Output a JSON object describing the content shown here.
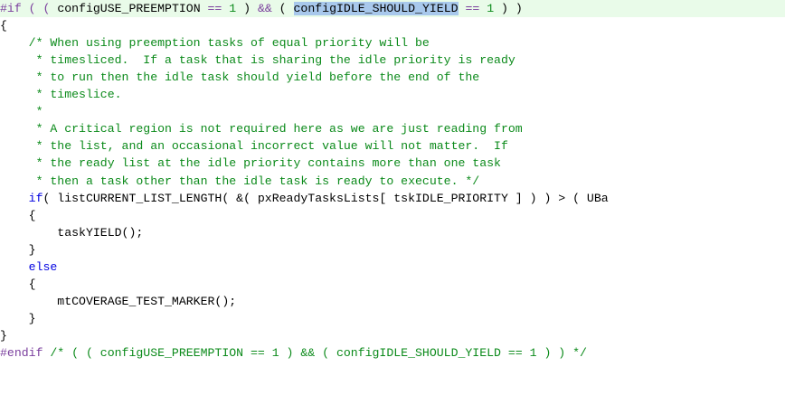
{
  "editor": {
    "lines": [
      {
        "highlight": true,
        "segs": [
          {
            "t": "#if",
            "c": "pre"
          },
          {
            "t": " ( ( ",
            "c": "pre"
          },
          {
            "t": "configUSE_PREEMPTION",
            "c": ""
          },
          {
            "t": " == ",
            "c": "op"
          },
          {
            "t": "1",
            "c": "num"
          },
          {
            "t": " ) ",
            "c": ""
          },
          {
            "t": "&&",
            "c": "op"
          },
          {
            "t": " ( ",
            "c": ""
          },
          {
            "t": "configIDLE_SHOULD_YIELD",
            "c": "sel"
          },
          {
            "t": " == ",
            "c": "op"
          },
          {
            "t": "1",
            "c": "num"
          },
          {
            "t": " ) )",
            "c": ""
          }
        ]
      },
      {
        "segs": [
          {
            "t": "{",
            "c": ""
          }
        ]
      },
      {
        "segs": [
          {
            "t": "    /* When using preemption tasks of equal priority will be",
            "c": "cm"
          }
        ]
      },
      {
        "segs": [
          {
            "t": "     * timesliced.  If a task that is sharing the idle priority is ready",
            "c": "cm"
          }
        ]
      },
      {
        "segs": [
          {
            "t": "     * to run then the idle task should yield before the end of the",
            "c": "cm"
          }
        ]
      },
      {
        "segs": [
          {
            "t": "     * timeslice.",
            "c": "cm"
          }
        ]
      },
      {
        "segs": [
          {
            "t": "     *",
            "c": "cm"
          }
        ]
      },
      {
        "segs": [
          {
            "t": "     * A critical region is not required here as we are just reading from",
            "c": "cm"
          }
        ]
      },
      {
        "segs": [
          {
            "t": "     * the list, and an occasional incorrect value will not matter.  If",
            "c": "cm"
          }
        ]
      },
      {
        "segs": [
          {
            "t": "     * the ready list at the idle priority contains more than one task",
            "c": "cm"
          }
        ]
      },
      {
        "segs": [
          {
            "t": "     * then a task other than the idle task is ready to execute. */",
            "c": "cm"
          }
        ]
      },
      {
        "segs": [
          {
            "t": "    ",
            "c": ""
          },
          {
            "t": "if",
            "c": "kw"
          },
          {
            "t": "( listCURRENT_LIST_LENGTH( &( pxReadyTasksLists[ tskIDLE_PRIORITY ] ) ) > ( UBa",
            "c": ""
          }
        ]
      },
      {
        "segs": [
          {
            "t": "    {",
            "c": ""
          }
        ]
      },
      {
        "segs": [
          {
            "t": "        taskYIELD();",
            "c": ""
          }
        ]
      },
      {
        "segs": [
          {
            "t": "    }",
            "c": ""
          }
        ]
      },
      {
        "segs": [
          {
            "t": "    ",
            "c": ""
          },
          {
            "t": "else",
            "c": "kw"
          }
        ]
      },
      {
        "segs": [
          {
            "t": "    {",
            "c": ""
          }
        ]
      },
      {
        "segs": [
          {
            "t": "        mtCOVERAGE_TEST_MARKER();",
            "c": ""
          }
        ]
      },
      {
        "segs": [
          {
            "t": "    }",
            "c": ""
          }
        ]
      },
      {
        "segs": [
          {
            "t": "}",
            "c": ""
          }
        ]
      },
      {
        "segs": [
          {
            "t": "#endif",
            "c": "pre"
          },
          {
            "t": " /* ( ( configUSE_PREEMPTION == 1 ) && ( configIDLE_SHOULD_YIELD == 1 ) ) */",
            "c": "cm"
          }
        ]
      }
    ]
  }
}
